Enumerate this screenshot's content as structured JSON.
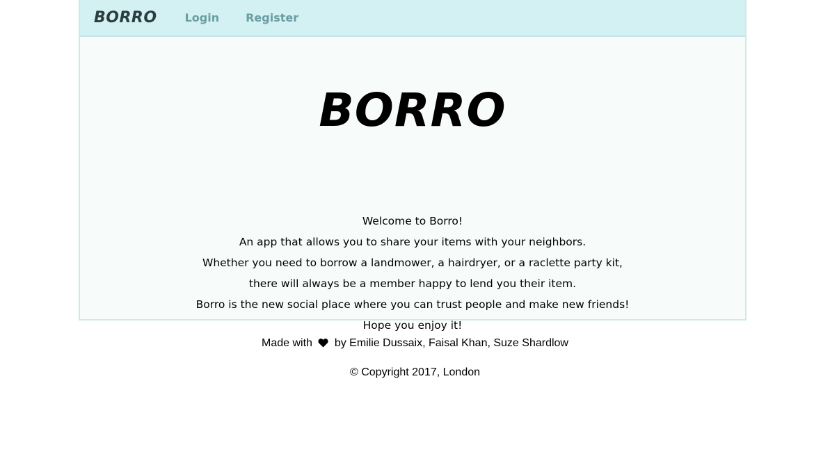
{
  "navbar": {
    "brand": "BORRO",
    "links": [
      {
        "label": "Login"
      },
      {
        "label": "Register"
      }
    ]
  },
  "hero": {
    "title": "BORRO",
    "lines": [
      "Welcome to Borro!",
      "An app that allows you to share your items with your neighbors.",
      "Whether you need to borrow a landmower, a hairdryer, or a raclette party kit,",
      "there will always be a member happy to lend you their item.",
      "Borro is the new social place where you can trust people and make new friends!",
      "Hope you enjoy it!"
    ]
  },
  "footer": {
    "made_with_prefix": "Made with",
    "made_with_suffix": "by Emilie Dussaix, Faisal Khan, Suze Shardlow",
    "copyright": "© Copyright 2017, London"
  },
  "colors": {
    "navbar_bg": "#d3f0f2",
    "nav_link": "#6a9ea3",
    "content_bg": "#f7fcfb",
    "border": "#cfe9e6"
  },
  "icons": {
    "heart": "heart-icon"
  }
}
